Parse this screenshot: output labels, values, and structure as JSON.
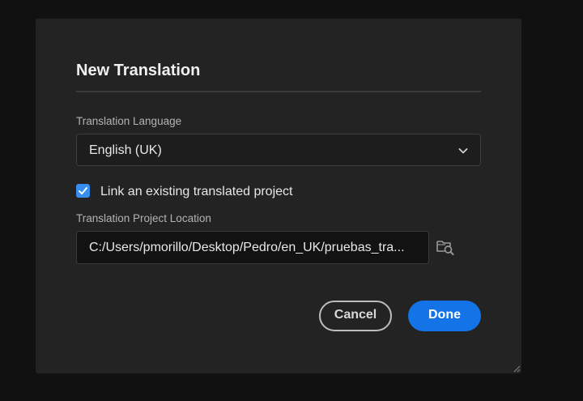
{
  "dialog": {
    "title": "New Translation",
    "language_label": "Translation Language",
    "language_value": "English (UK)",
    "link_checkbox": {
      "label": "Link an existing translated project",
      "checked": true
    },
    "location_label": "Translation Project Location",
    "location_value": "C:/Users/pmorillo/Desktop/Pedro/en_UK/pruebas_tra...",
    "cancel_label": "Cancel",
    "done_label": "Done"
  },
  "icons": {
    "dropdown": "chevron-down-icon",
    "browse": "folder-search-icon",
    "checkbox": "checkmark-icon",
    "resize": "resize-grip-icon"
  },
  "colors": {
    "accent": "#1473e6",
    "checkbox": "#378ef0",
    "dialog_bg": "#232323",
    "page_bg": "#111111"
  }
}
